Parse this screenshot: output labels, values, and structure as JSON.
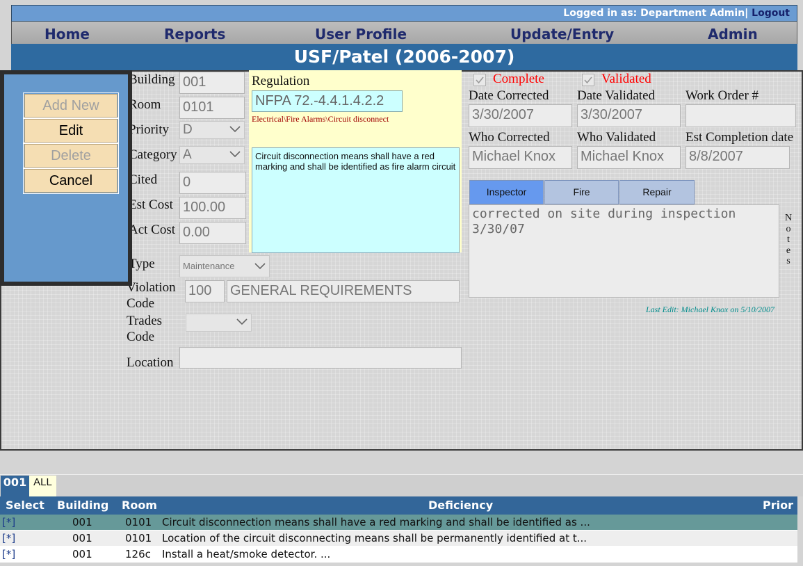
{
  "header": {
    "logged_in_text": "Logged in as: Department Admin|",
    "logout_label": "Logout",
    "nav": [
      "Home",
      "Reports",
      "User Profile",
      "Update/Entry",
      "Admin"
    ],
    "title": "USF/Patel (2006-2007)"
  },
  "actions": {
    "add_new": "Add New",
    "edit": "Edit",
    "delete": "Delete",
    "cancel": "Cancel"
  },
  "form": {
    "building": {
      "label": "Building",
      "value": "001"
    },
    "room": {
      "label": "Room",
      "value": "0101"
    },
    "priority": {
      "label": "Priority",
      "value": "D"
    },
    "category": {
      "label": "Category",
      "value": "A"
    },
    "cited": {
      "label": "Cited",
      "value": "0"
    },
    "est_cost": {
      "label": "Est Cost",
      "value": "100.00"
    },
    "act_cost": {
      "label": "Act Cost",
      "value": "0.00"
    },
    "type": {
      "label": "Type",
      "value": "Maintenance"
    },
    "violation_code": {
      "label_1": "Violation",
      "label_2": "Code",
      "code": "100",
      "description": "GENERAL REQUIREMENTS"
    },
    "trades_code": {
      "label_1": "Trades",
      "label_2": "Code",
      "value": ""
    },
    "location": {
      "label": "Location",
      "value": ""
    }
  },
  "regulation": {
    "label": "Regulation",
    "code": "NFPA 72.-4.4.1.4.2.2",
    "path": "Electrical\\Fire Alarms\\Circuit disconnect",
    "text": "Circuit disconnection means shall have a red marking and shall be identified as fire alarm circuit"
  },
  "status": {
    "complete_label": "Complete",
    "validated_label": "Validated",
    "complete_checked": true,
    "validated_checked": true,
    "date_corrected": {
      "label": "Date Corrected",
      "value": "3/30/2007"
    },
    "date_validated": {
      "label": "Date Validated",
      "value": "3/30/2007"
    },
    "work_order": {
      "label": "Work Order #",
      "value": ""
    },
    "who_corrected": {
      "label": "Who Corrected",
      "value": "Michael Knox"
    },
    "who_validated": {
      "label": "Who Validated",
      "value": "Michael Knox"
    },
    "est_completion": {
      "label": "Est Completion date",
      "value": "8/8/2007"
    }
  },
  "notes": {
    "tabs": [
      "Inspector",
      "Fire",
      "Repair"
    ],
    "active_tab": "Inspector",
    "text": "corrected on site during inspection 3/30/07",
    "side_label": [
      "N",
      "o",
      "t",
      "e",
      "s"
    ],
    "last_edit": "Last Edit: Michael Knox on 5/10/2007"
  },
  "list": {
    "subtabs": [
      "001",
      "ALL"
    ],
    "columns": [
      "Select",
      "Building",
      "Room",
      "Deficiency",
      "Prior"
    ],
    "rows": [
      {
        "select": "[*]",
        "building": "001",
        "room": "0101",
        "deficiency": "Circuit disconnection means shall have a red marking and shall be identified as ..."
      },
      {
        "select": "[*]",
        "building": "001",
        "room": "0101",
        "deficiency": "Location of the circuit disconnecting means shall be permanently identified at t..."
      },
      {
        "select": "[*]",
        "building": "001",
        "room": "126c",
        "deficiency": "Install a heat/smoke detector. ..."
      }
    ]
  },
  "colors": {
    "header_blue": "#6a9bd2",
    "title_blue": "#2e6aa0",
    "nav_text": "#1f2a6d",
    "regulation_bg": "#ffffcc",
    "regulation_field_bg": "#ccffff",
    "status_red": "#ff0000",
    "selected_row": "#669999",
    "tab_active": "#6699ee"
  }
}
